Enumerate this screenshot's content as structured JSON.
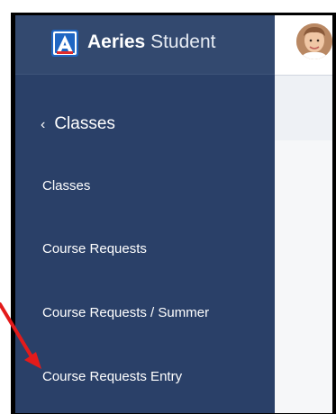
{
  "brand": {
    "logo_letter": "A",
    "name_bold": "Aeries",
    "name_light": "Student"
  },
  "sidebar": {
    "back_label": "Classes",
    "items": [
      {
        "label": "Classes"
      },
      {
        "label": "Course Requests"
      },
      {
        "label": "Course Requests / Summer"
      },
      {
        "label": "Course Requests Entry"
      }
    ]
  },
  "colors": {
    "sidebar": "#2a4068",
    "brand_bar": "#33496f",
    "logo": "#1f66c3",
    "annotation_arrow": "#e31b1b"
  }
}
